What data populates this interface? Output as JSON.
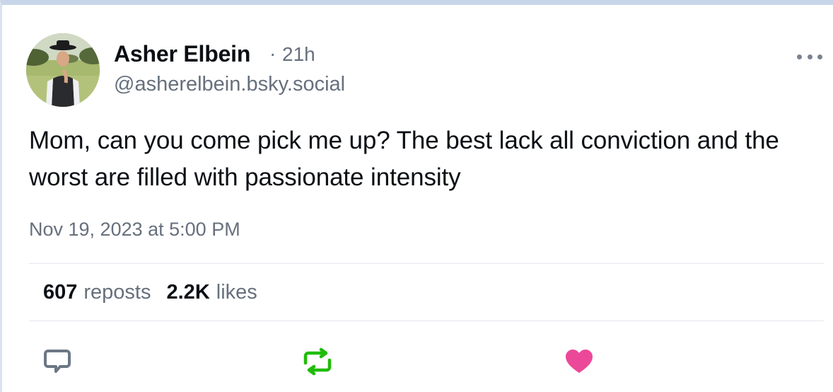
{
  "author": {
    "display_name": "Asher Elbein",
    "separator": "·",
    "relative_time": "21h",
    "handle": "@asherelbein.bsky.social"
  },
  "post": {
    "text": "Mom, can you come pick me up? The best lack all conviction and the worst are filled with passionate intensity",
    "timestamp": "Nov 19, 2023 at 5:00 PM"
  },
  "stats": {
    "reposts_count": "607",
    "reposts_label": "reposts",
    "likes_count": "2.2K",
    "likes_label": "likes"
  },
  "actions": {
    "reply_icon": "speech-bubble-icon",
    "repost_icon": "repost-arrows-icon",
    "like_icon": "heart-icon",
    "more_icon": "ellipsis-icon"
  },
  "colors": {
    "text_primary": "#0b0f14",
    "text_secondary": "#66707d",
    "reply_icon": "#6b7785",
    "repost_active": "#20bc07",
    "like_active": "#ec4899"
  }
}
